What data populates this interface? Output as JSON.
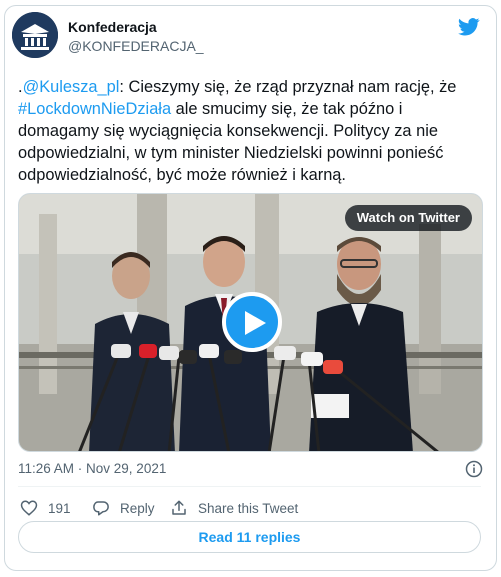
{
  "author": {
    "name": "Konfederacja",
    "handle": "@KONFEDERACJA_",
    "avatar_icon": "konfederacja-logo"
  },
  "tweet": {
    "prefix": ".",
    "mention": "@Kulesza_pl",
    "text_part1": ": Cieszymy się, że rząd przyznał nam rację, że ",
    "hashtag": "#LockdownNieDziała",
    "text_part2": " ale smucimy się, że tak późno i domagamy się wyciągnięcia konsekwencji. Politycy za nie odpowiedzialni, w tym minister Niedzielski powinni ponieść odpowiedzialność, być może również i karną."
  },
  "media": {
    "watch_label": "Watch on Twitter",
    "play_icon": "play-icon"
  },
  "meta": {
    "timestamp": "11:26 AM · Nov 29, 2021"
  },
  "actions": {
    "likes": "191",
    "reply_label": "Reply",
    "share_label": "Share this Tweet"
  },
  "read_replies_label": "Read 11 replies",
  "colors": {
    "accent": "#1d9bf0",
    "text": "#0f1419",
    "muted": "#536471",
    "border": "#cfd9de"
  }
}
